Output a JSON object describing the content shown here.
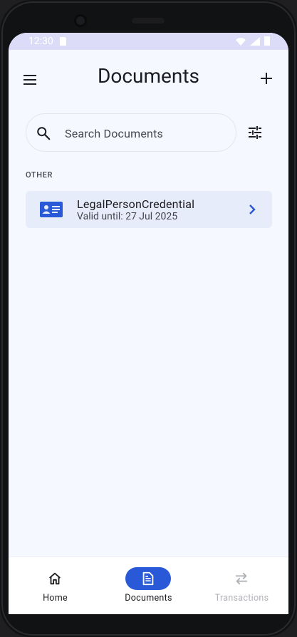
{
  "status_bar": {
    "time": "12:30"
  },
  "header": {
    "title": "Documents"
  },
  "search": {
    "placeholder": "Search Documents",
    "value": ""
  },
  "section": {
    "label": "OTHER"
  },
  "documents": [
    {
      "title": "LegalPersonCredential",
      "subtitle": "Valid until: 27 Jul 2025"
    }
  ],
  "bottom_nav": {
    "items": [
      {
        "label": "Home",
        "icon": "home-icon",
        "state": "normal"
      },
      {
        "label": "Documents",
        "icon": "document-icon",
        "state": "active"
      },
      {
        "label": "Transactions",
        "icon": "swap-arrows-icon",
        "state": "disabled"
      }
    ]
  },
  "colors": {
    "accent": "#2a59d8",
    "background": "#f5f8ff",
    "card": "#e6ecf9",
    "status_bar": "#dcdcf8"
  }
}
